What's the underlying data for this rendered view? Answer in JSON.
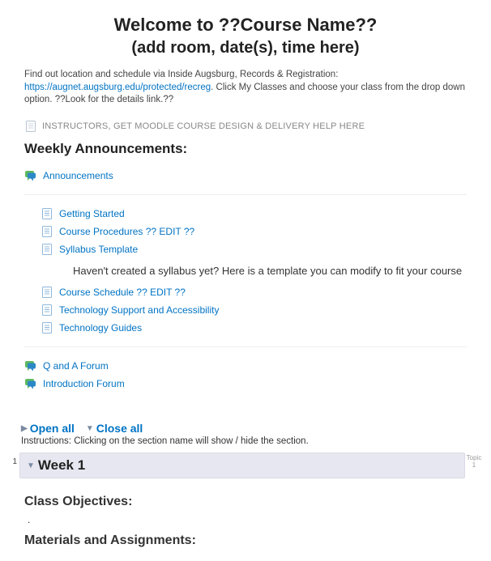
{
  "header": {
    "title": "Welcome to ??Course Name??",
    "subtitle": "(add room, date(s), time here)",
    "intro_pre": "Find out location and schedule via Inside Augsburg, Records & Registration: ",
    "intro_link_text": "https://augnet.augsburg.edu/protected/recreg",
    "intro_post": ". Click My Classes and choose your class from the drop down option. ??Look for the details link.??"
  },
  "help": {
    "label": "INSTRUCTORS, GET MOODLE COURSE DESIGN & DELIVERY HELP HERE"
  },
  "announcements": {
    "heading": "Weekly Announcements:",
    "forum_link": "Announcements"
  },
  "resources_top": {
    "items": [
      {
        "label": "Getting Started"
      },
      {
        "label": "Course Procedures ?? EDIT ??"
      },
      {
        "label": "Syllabus Template"
      }
    ],
    "syllabus_desc": "Haven't created a syllabus yet? Here is a template you can modify to fit your course"
  },
  "resources_bottom": {
    "items": [
      {
        "label": "Course Schedule ?? EDIT ??"
      },
      {
        "label": "Technology Support and Accessibility"
      },
      {
        "label": "Technology Guides"
      }
    ]
  },
  "forums": {
    "items": [
      {
        "label": "Q and A Forum"
      },
      {
        "label": "Introduction Forum"
      }
    ]
  },
  "collapse": {
    "open_all": "Open all",
    "close_all": "Close all",
    "instructions": "Instructions: Clicking on the section name will show / hide the section."
  },
  "week": {
    "number": "1",
    "title": "Week 1",
    "side_label_top": "Topic",
    "side_label_bottom": "1",
    "objectives_heading": "Class Objectives:",
    "bullet": ".",
    "materials_heading": "Materials and Assignments:"
  }
}
